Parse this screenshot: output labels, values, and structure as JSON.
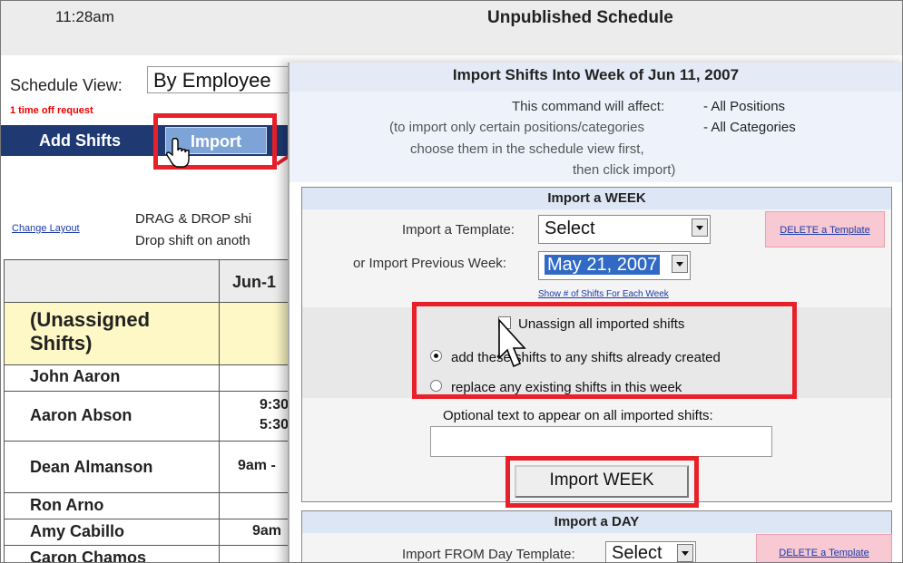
{
  "header": {
    "time": "11:28am",
    "title": "Unpublished Schedule"
  },
  "schedule_view": {
    "label": "Schedule View:",
    "value": "By Employee"
  },
  "time_off_request": "1 time off request",
  "toolbar": {
    "add_shifts": "Add Shifts",
    "import": "Import"
  },
  "layout": {
    "change_layout": "Change Layout",
    "drag_drop_line1": "DRAG & DROP shi",
    "drag_drop_line2": "Drop shift on anoth"
  },
  "table": {
    "date_header": "Jun-1",
    "rows": [
      {
        "name": "(Unassigned",
        "name2": "Shifts)",
        "shift": ""
      },
      {
        "name": "John Aaron",
        "shift": ""
      },
      {
        "name": "Aaron Abson",
        "shift": "9:30",
        "shift2": "5:30"
      },
      {
        "name": "Dean Almanson",
        "shift": "9am -"
      },
      {
        "name": "Ron Arno",
        "shift": ""
      },
      {
        "name": "Amy Cabillo",
        "shift": "9am"
      },
      {
        "name": "Caron Chamos",
        "shift": ""
      }
    ]
  },
  "dialog": {
    "title": "Import Shifts Into Week of Jun 11, 2007",
    "affect_label": "This command will affect:",
    "affect_note_line1": "(to import only certain positions/categories",
    "affect_note_line2": "choose them in the schedule view first,",
    "affect_note_line3": "then click import)",
    "positions": "- All Positions",
    "categories": "- All Categories",
    "week_section": {
      "header": "Import a WEEK",
      "template_label": "Import a Template:",
      "template_value": "Select",
      "delete_template": "DELETE a Template",
      "prev_week_label": "or Import Previous Week:",
      "prev_week_value": "May 21, 2007",
      "show_shifts_link": "Show # of Shifts For Each Week",
      "unassign_label": "Unassign all imported shifts",
      "add_option": "add these shifts to any shifts already created",
      "replace_option": "replace any existing shifts in this week",
      "optional_text_label": "Optional text to appear on all imported shifts:",
      "optional_text_value": "",
      "import_week_button": "Import WEEK"
    },
    "day_section": {
      "header": "Import a DAY",
      "template_label": "Import FROM Day Template:",
      "template_value": "Select",
      "delete_template": "DELETE a Template"
    }
  },
  "colors": {
    "toolbar": "#1f3a73",
    "highlight": "#e8202a",
    "unassigned_row": "#fdf8c5",
    "delete_bg": "#f8c9d3"
  }
}
